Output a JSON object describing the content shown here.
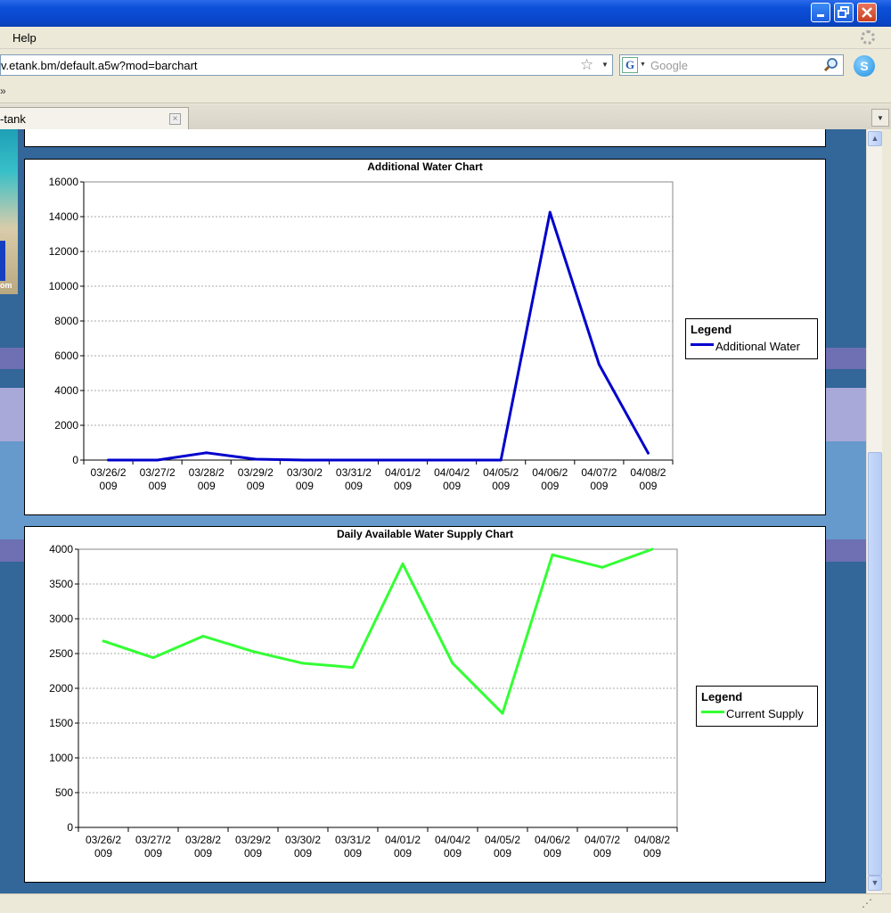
{
  "browser": {
    "menu": {
      "help": "Help"
    },
    "url": "v.etank.bm/default.a5w?mod=barchart",
    "search_placeholder": "Google",
    "tab_label": "-tank",
    "bookmarks_chevron": "»"
  },
  "side_image": {
    "text": "om"
  },
  "icons": {
    "minimize": "minimize-icon",
    "restore": "restore-icon",
    "close": "close-icon",
    "star": "star-icon",
    "google": "google-icon",
    "search": "magnifier-icon",
    "skype": "skype-icon",
    "throbber": "throbber-icon"
  },
  "charts": [
    {
      "title": "Additional Water Chart",
      "legend_title": "Legend",
      "legend_label": "Additional Water",
      "color": "#0000cc"
    },
    {
      "title": "Daily Available Water Supply Chart",
      "legend_title": "Legend",
      "legend_label": "Current Supply",
      "color": "#33ff33"
    }
  ],
  "chart_data": [
    {
      "type": "line",
      "title": "Additional Water Chart",
      "categories": [
        "03/26/2009",
        "03/27/2009",
        "03/28/2009",
        "03/29/2009",
        "03/30/2009",
        "03/31/2009",
        "04/01/2009",
        "04/04/2009",
        "04/05/2009",
        "04/06/2009",
        "04/07/2009",
        "04/08/2009"
      ],
      "tick_labels": [
        [
          "03/26/2",
          "009"
        ],
        [
          "03/27/2",
          "009"
        ],
        [
          "03/28/2",
          "009"
        ],
        [
          "03/29/2",
          "009"
        ],
        [
          "03/30/2",
          "009"
        ],
        [
          "03/31/2",
          "009"
        ],
        [
          "04/01/2",
          "009"
        ],
        [
          "04/04/2",
          "009"
        ],
        [
          "04/05/2",
          "009"
        ],
        [
          "04/06/2",
          "009"
        ],
        [
          "04/07/2",
          "009"
        ],
        [
          "04/08/2",
          "009"
        ]
      ],
      "series": [
        {
          "name": "Additional Water",
          "values": [
            0,
            0,
            420,
            50,
            0,
            0,
            0,
            0,
            0,
            14250,
            5500,
            400
          ]
        }
      ],
      "yticks": [
        0,
        2000,
        4000,
        6000,
        8000,
        10000,
        12000,
        14000,
        16000
      ],
      "ylim": [
        0,
        16000
      ],
      "grid": true,
      "legend": "right",
      "color": "#0000cc"
    },
    {
      "type": "line",
      "title": "Daily Available Water Supply Chart",
      "categories": [
        "03/26/2009",
        "03/27/2009",
        "03/28/2009",
        "03/29/2009",
        "03/30/2009",
        "03/31/2009",
        "04/01/2009",
        "04/04/2009",
        "04/05/2009",
        "04/06/2009",
        "04/07/2009",
        "04/08/2009"
      ],
      "tick_labels": [
        [
          "03/26/2",
          "009"
        ],
        [
          "03/27/2",
          "009"
        ],
        [
          "03/28/2",
          "009"
        ],
        [
          "03/29/2",
          "009"
        ],
        [
          "03/30/2",
          "009"
        ],
        [
          "03/31/2",
          "009"
        ],
        [
          "04/01/2",
          "009"
        ],
        [
          "04/04/2",
          "009"
        ],
        [
          "04/05/2",
          "009"
        ],
        [
          "04/06/2",
          "009"
        ],
        [
          "04/07/2",
          "009"
        ],
        [
          "04/08/2",
          "009"
        ]
      ],
      "series": [
        {
          "name": "Current Supply",
          "values": [
            2680,
            2440,
            2750,
            2530,
            2360,
            2300,
            3790,
            2360,
            1640,
            3920,
            3740,
            4000
          ]
        }
      ],
      "yticks": [
        0,
        500,
        1000,
        1500,
        2000,
        2500,
        3000,
        3500,
        4000
      ],
      "ylim": [
        0,
        4000
      ],
      "grid": true,
      "legend": "right",
      "color": "#33ff33"
    }
  ]
}
